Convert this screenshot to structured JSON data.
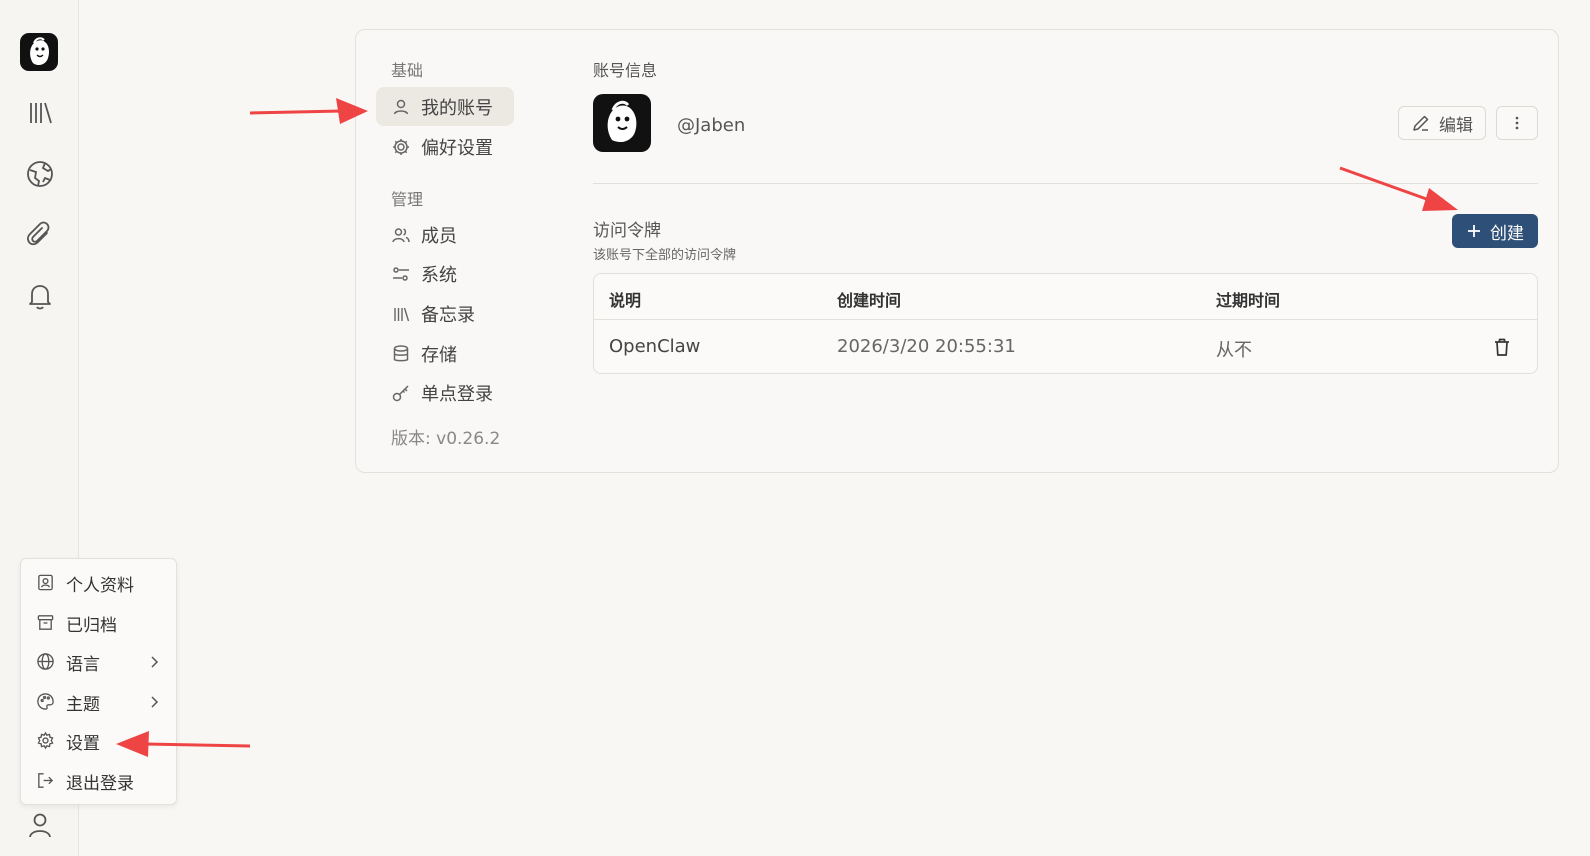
{
  "sidebar_rail": {
    "icons": [
      "app-logo",
      "library-icon",
      "globe-icon",
      "paperclip-icon",
      "bell-icon",
      "user-icon"
    ]
  },
  "settings_nav": {
    "section_basic": "基础",
    "my_account": "我的账号",
    "preferences": "偏好设置",
    "section_admin": "管理",
    "members": "成员",
    "system": "系统",
    "memos": "备忘录",
    "storage": "存储",
    "sso": "单点登录",
    "version": "版本: v0.26.2"
  },
  "account": {
    "title": "账号信息",
    "username": "@Jaben",
    "edit_label": "编辑"
  },
  "tokens": {
    "title": "访问令牌",
    "subtitle": "该账号下全部的访问令牌",
    "create_label": "创建",
    "columns": [
      "说明",
      "创建时间",
      "过期时间"
    ],
    "rows": [
      {
        "description": "OpenClaw",
        "created": "2026/3/20 20:55:31",
        "expires": "从不"
      }
    ]
  },
  "user_menu": {
    "profile": "个人资料",
    "archived": "已归档",
    "language": "语言",
    "theme": "主题",
    "settings": "设置",
    "logout": "退出登录"
  },
  "colors": {
    "accent": "#2e4f77",
    "annotation_arrow": "#ef4444",
    "background": "#f8f7f4"
  }
}
